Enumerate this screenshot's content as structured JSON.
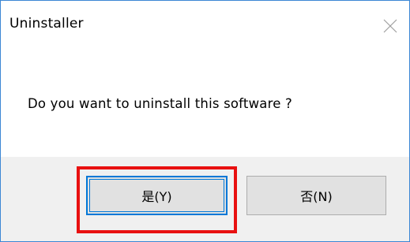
{
  "window": {
    "title": "Uninstaller",
    "accent_color": "#0078d7",
    "border_color": "#3c87d4"
  },
  "titlebar": {
    "close_icon": "close-icon"
  },
  "message": {
    "text": "Do you want to uninstall this software ?"
  },
  "buttons": {
    "yes_label": "是(Y)",
    "no_label": "否(N)"
  },
  "annotation": {
    "highlight_color": "#e81010",
    "highlight_target": "yes-button"
  }
}
